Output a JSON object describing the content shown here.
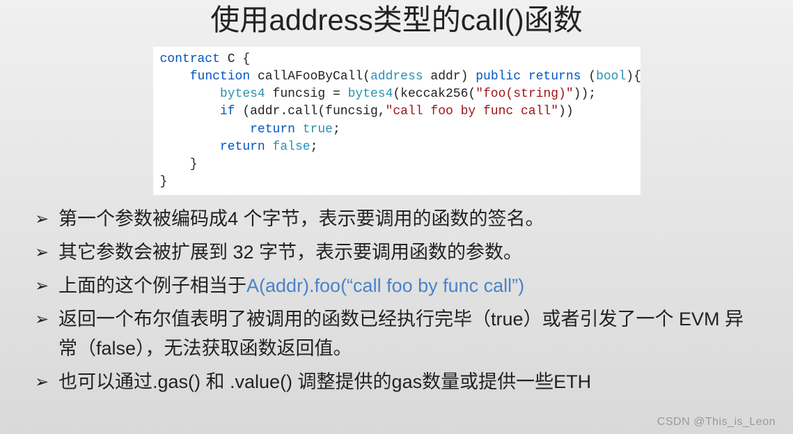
{
  "title": "使用address类型的call()函数",
  "code": {
    "l1_kw": "contract",
    "l1_rest": " C {",
    "l2_kw1": "function",
    "l2_name": " callAFooByCall(",
    "l2_type1": "address",
    "l2_param": " addr) ",
    "l2_kw2": "public",
    "l2_kw3": " returns ",
    "l2_p_open": "(",
    "l2_type2": "bool",
    "l2_p_close": "){",
    "l3_type": "bytes4",
    "l3_mid": " funcsig = ",
    "l3_type2": "bytes4",
    "l3_call": "(keccak256(",
    "l3_str": "\"foo(string)\"",
    "l3_end": "));",
    "l4_kw": "if",
    "l4_mid": " (addr.call(funcsig,",
    "l4_str": "\"call foo by func call\"",
    "l4_end": "))",
    "l5_kw": "return",
    "l5_sp": " ",
    "l5_val": "true",
    "l5_end": ";",
    "l6_kw": "return",
    "l6_sp": " ",
    "l6_val": "false",
    "l6_end": ";",
    "l7": "    }",
    "l8": "}"
  },
  "bullets": {
    "marker": "➢",
    "b1": "第一个参数被编码成4 个字节，表示要调用的函数的签名。",
    "b2": "其它参数会被扩展到 32 字节，表示要调用函数的参数。",
    "b3_pre": "上面的这个例子相当于",
    "b3_code": "A(addr).foo(“call foo by func call”)",
    "b4": "返回一个布尔值表明了被调用的函数已经执行完毕（true）或者引发了一个 EVM 异常（false），无法获取函数返回值。",
    "b5": "也可以通过.gas() 和 .value() 调整提供的gas数量或提供一些ETH"
  },
  "watermark": "CSDN @This_is_Leon"
}
